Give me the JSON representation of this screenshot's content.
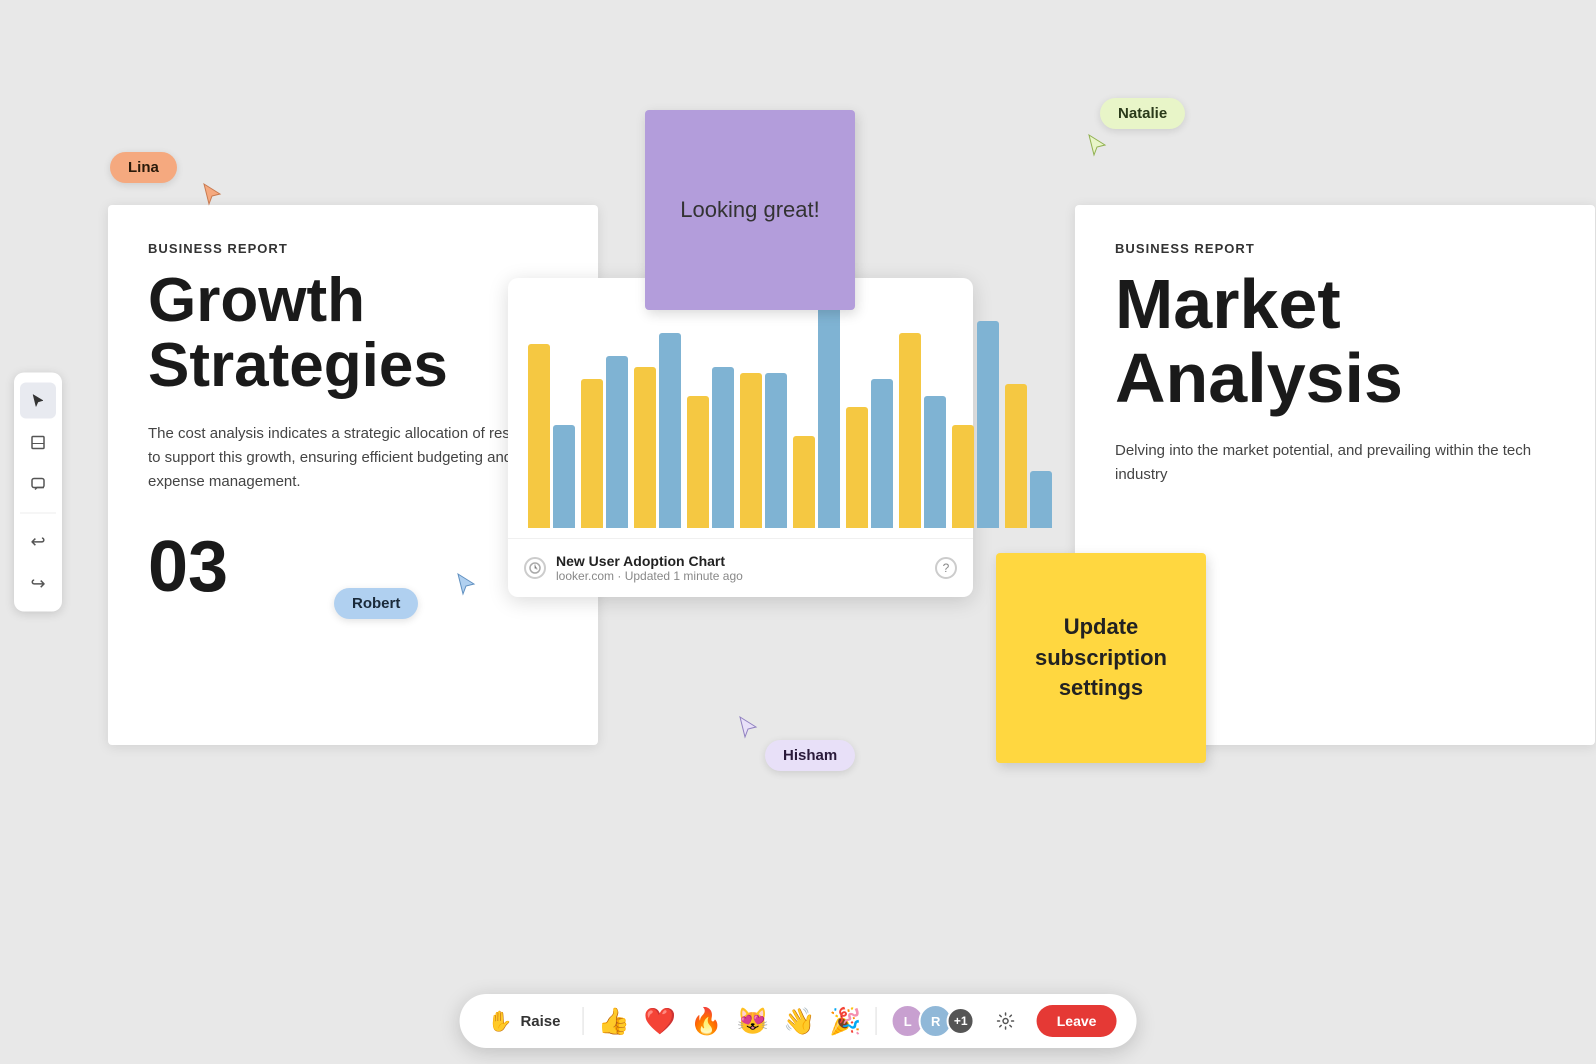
{
  "app": {
    "background": "#e8e8e8"
  },
  "toolbar": {
    "tools": [
      {
        "id": "select",
        "icon": "▶",
        "active": true
      },
      {
        "id": "sticky",
        "icon": "☐",
        "active": false
      },
      {
        "id": "comment",
        "icon": "💬",
        "active": false
      }
    ],
    "undo_label": "⟲",
    "redo_label": "⟳"
  },
  "cards": {
    "left": {
      "report_label": "BUSINESS REPORT",
      "title": "Growth Strategies",
      "description": "The cost analysis indicates a strategic allocation of resources to support this growth, ensuring efficient budgeting and expense management.",
      "number": "03"
    },
    "right": {
      "report_label": "BUSINESS REPORT",
      "title": "Market Analysis",
      "description": "Delving into the market potential, and prevailing within the tech industry"
    }
  },
  "chart": {
    "title": "New User Adoption Chart",
    "source": "looker.com",
    "updated": "Updated 1 minute ago",
    "bars": [
      {
        "yellow": 160,
        "blue": 90
      },
      {
        "yellow": 130,
        "blue": 150
      },
      {
        "yellow": 140,
        "blue": 170
      },
      {
        "yellow": 115,
        "blue": 140
      },
      {
        "yellow": 135,
        "blue": 135
      },
      {
        "yellow": 80,
        "blue": 195
      },
      {
        "yellow": 105,
        "blue": 130
      },
      {
        "yellow": 170,
        "blue": 115
      },
      {
        "yellow": 90,
        "blue": 180
      },
      {
        "yellow": 125,
        "blue": 50
      }
    ]
  },
  "sticky_notes": {
    "purple": {
      "text": "Looking great!",
      "color": "#b39ddb"
    },
    "yellow": {
      "text": "Update subscription settings",
      "color": "#ffd740"
    }
  },
  "cursors": {
    "lina": {
      "name": "Lina",
      "color": "#f5a97f"
    },
    "robert": {
      "name": "Robert",
      "color": "#b0d0f0"
    },
    "natalie": {
      "name": "Natalie",
      "color": "#e8f5c8"
    },
    "hisham": {
      "name": "Hisham",
      "color": "#e8e0f8"
    }
  },
  "bottom_bar": {
    "raise_label": "Raise",
    "emojis": [
      "👍",
      "❤️",
      "🔥",
      "😻",
      "👋",
      "🎉"
    ],
    "leave_label": "Leave",
    "participants_extra": "+1"
  }
}
